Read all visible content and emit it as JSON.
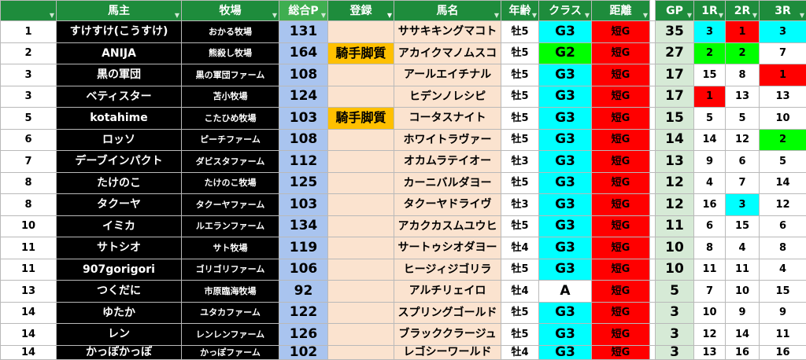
{
  "headers": {
    "blank": "",
    "owner": "馬主",
    "farm": "牧場",
    "total": "総合P",
    "reg": "登録",
    "horse": "馬名",
    "age": "年齢",
    "cls": "クラス",
    "dist": "距離",
    "gp": "GP",
    "r1": "1R",
    "r2": "2R",
    "r3": "3R"
  },
  "filter_icon": "dropdown-triangle",
  "filter_active_icon": "funnel",
  "colors": {
    "header_green": "#1e8c3c",
    "owner_black": "#000000",
    "total_blue": "#a9c4ef",
    "horse_peach": "#fbe3cf",
    "reg_orange": "#ffc000",
    "class_cyan": "#00ffff",
    "class_green": "#00ff00",
    "dist_red": "#ff0000",
    "gp_green": "#d6ead6"
  },
  "rows": [
    {
      "rank": "1",
      "owner": "すけすけ(こうすけ)",
      "farm": "おかる牧場",
      "total": "131",
      "reg": "",
      "horse": "ササキキングマコト",
      "age": "牡5",
      "cls": "G3",
      "dist": "短G",
      "gp": "35",
      "r1": "3",
      "r2": "1",
      "r3": "3",
      "cls_bg": "#00ffff",
      "r1_bg": "#00ffff",
      "r2_bg": "#ff0000",
      "r3_bg": "#00ffff"
    },
    {
      "rank": "2",
      "owner": "ANIJA",
      "farm": "熊殺し牧場",
      "total": "164",
      "reg": "騎手脚質",
      "horse": "アカイクマノムスコ",
      "age": "牡5",
      "cls": "G2",
      "dist": "短G",
      "gp": "27",
      "r1": "2",
      "r2": "2",
      "r3": "7",
      "cls_bg": "#00ff00",
      "r1_bg": "#00ff00",
      "r2_bg": "#00ff00",
      "r3_bg": "#ffffff"
    },
    {
      "rank": "3",
      "owner": "黒の軍団",
      "farm": "黒の軍団ファーム",
      "total": "108",
      "reg": "",
      "horse": "アールエイチナル",
      "age": "牡5",
      "cls": "G3",
      "dist": "短G",
      "gp": "17",
      "r1": "15",
      "r2": "8",
      "r3": "1",
      "cls_bg": "#00ffff",
      "r1_bg": "#ffffff",
      "r2_bg": "#ffffff",
      "r3_bg": "#ff0000"
    },
    {
      "rank": "3",
      "owner": "ベティスター",
      "farm": "苫小牧場",
      "total": "124",
      "reg": "",
      "horse": "ヒデンノレシピ",
      "age": "牡5",
      "cls": "G3",
      "dist": "短G",
      "gp": "17",
      "r1": "1",
      "r2": "13",
      "r3": "13",
      "cls_bg": "#00ffff",
      "r1_bg": "#ff0000",
      "r2_bg": "#ffffff",
      "r3_bg": "#ffffff"
    },
    {
      "rank": "5",
      "owner": "kotahime",
      "farm": "こたひめ牧場",
      "total": "103",
      "reg": "騎手脚質",
      "horse": "コータスナイト",
      "age": "牡5",
      "cls": "G3",
      "dist": "短G",
      "gp": "15",
      "r1": "5",
      "r2": "5",
      "r3": "10",
      "cls_bg": "#00ffff",
      "r1_bg": "#ffffff",
      "r2_bg": "#ffffff",
      "r3_bg": "#ffffff"
    },
    {
      "rank": "6",
      "owner": "ロッソ",
      "farm": "ピーチファーム",
      "total": "108",
      "reg": "",
      "horse": "ホワイトラヴァー",
      "age": "牡5",
      "cls": "G3",
      "dist": "短G",
      "gp": "14",
      "r1": "14",
      "r2": "12",
      "r3": "2",
      "cls_bg": "#00ffff",
      "r1_bg": "#ffffff",
      "r2_bg": "#ffffff",
      "r3_bg": "#00ff00"
    },
    {
      "rank": "7",
      "owner": "デーブインパクト",
      "farm": "ダビスタファーム",
      "total": "112",
      "reg": "",
      "horse": "オカムラテイオー",
      "age": "牡3",
      "cls": "G3",
      "dist": "短G",
      "gp": "13",
      "r1": "9",
      "r2": "6",
      "r3": "5",
      "cls_bg": "#00ffff",
      "r1_bg": "#ffffff",
      "r2_bg": "#ffffff",
      "r3_bg": "#ffffff"
    },
    {
      "rank": "8",
      "owner": "たけのこ",
      "farm": "たけのこ牧場",
      "total": "125",
      "reg": "",
      "horse": "カーニバルダヨー",
      "age": "牡5",
      "cls": "G3",
      "dist": "短G",
      "gp": "12",
      "r1": "4",
      "r2": "7",
      "r3": "14",
      "cls_bg": "#00ffff",
      "r1_bg": "#ffffff",
      "r2_bg": "#ffffff",
      "r3_bg": "#ffffff"
    },
    {
      "rank": "8",
      "owner": "タクーヤ",
      "farm": "タクーヤファーム",
      "total": "103",
      "reg": "",
      "horse": "タクーヤドライヴ",
      "age": "牡3",
      "cls": "G3",
      "dist": "短G",
      "gp": "12",
      "r1": "16",
      "r2": "3",
      "r3": "12",
      "cls_bg": "#00ffff",
      "r1_bg": "#ffffff",
      "r2_bg": "#00ffff",
      "r3_bg": "#ffffff"
    },
    {
      "rank": "10",
      "owner": "イミカ",
      "farm": "ルエランファーム",
      "total": "134",
      "reg": "",
      "horse": "アカクカスムユウヒ",
      "age": "牡5",
      "cls": "G3",
      "dist": "短G",
      "gp": "11",
      "r1": "6",
      "r2": "15",
      "r3": "6",
      "cls_bg": "#00ffff",
      "r1_bg": "#ffffff",
      "r2_bg": "#ffffff",
      "r3_bg": "#ffffff"
    },
    {
      "rank": "11",
      "owner": "サトシオ",
      "farm": "サト牧場",
      "total": "119",
      "reg": "",
      "horse": "サートゥシオダヨー",
      "age": "牡4",
      "cls": "G3",
      "dist": "短G",
      "gp": "10",
      "r1": "8",
      "r2": "4",
      "r3": "8",
      "cls_bg": "#00ffff",
      "r1_bg": "#ffffff",
      "r2_bg": "#ffffff",
      "r3_bg": "#ffffff"
    },
    {
      "rank": "11",
      "owner": "907gorigori",
      "farm": "ゴリゴリファーム",
      "total": "106",
      "reg": "",
      "horse": "ヒージィジゴリラ",
      "age": "牡5",
      "cls": "G3",
      "dist": "短G",
      "gp": "10",
      "r1": "11",
      "r2": "11",
      "r3": "4",
      "cls_bg": "#00ffff",
      "r1_bg": "#ffffff",
      "r2_bg": "#ffffff",
      "r3_bg": "#ffffff"
    },
    {
      "rank": "13",
      "owner": "つくだに",
      "farm": "市原臨海牧場",
      "total": "92",
      "reg": "",
      "horse": "アルチリェイロ",
      "age": "牡4",
      "cls": "A",
      "dist": "短G",
      "gp": "5",
      "r1": "7",
      "r2": "10",
      "r3": "15",
      "cls_bg": "#ffffff",
      "r1_bg": "#ffffff",
      "r2_bg": "#ffffff",
      "r3_bg": "#ffffff"
    },
    {
      "rank": "14",
      "owner": "ゆたか",
      "farm": "ユタカファーム",
      "total": "122",
      "reg": "",
      "horse": "スプリングゴールド",
      "age": "牡5",
      "cls": "G3",
      "dist": "短G",
      "gp": "3",
      "r1": "10",
      "r2": "9",
      "r3": "9",
      "cls_bg": "#00ffff",
      "r1_bg": "#ffffff",
      "r2_bg": "#ffffff",
      "r3_bg": "#ffffff"
    },
    {
      "rank": "14",
      "owner": "レン",
      "farm": "レンレンファーム",
      "total": "126",
      "reg": "",
      "horse": "ブラッククラージュ",
      "age": "牡5",
      "cls": "G3",
      "dist": "短G",
      "gp": "3",
      "r1": "12",
      "r2": "14",
      "r3": "11",
      "cls_bg": "#00ffff",
      "r1_bg": "#ffffff",
      "r2_bg": "#ffffff",
      "r3_bg": "#ffffff"
    },
    {
      "rank": "14",
      "owner": "かっぽかっぽ",
      "farm": "かっぽファーム",
      "total": "102",
      "reg": "",
      "horse": "レゴシーワールド",
      "age": "牡4",
      "cls": "G3",
      "dist": "短G",
      "gp": "3",
      "r1": "13",
      "r2": "16",
      "r3": "16",
      "cls_bg": "#00ffff",
      "r1_bg": "#ffffff",
      "r2_bg": "#ffffff",
      "r3_bg": "#ffffff"
    }
  ]
}
